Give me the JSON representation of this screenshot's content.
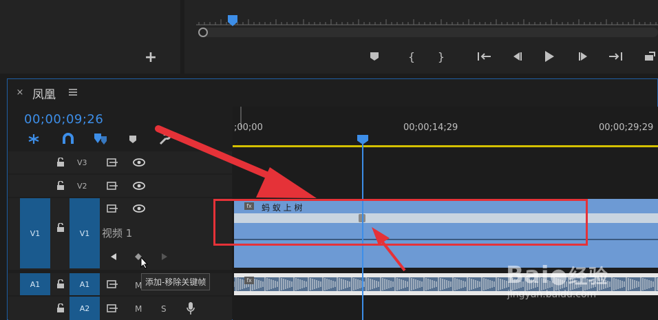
{
  "monitor": {
    "add_label": "+"
  },
  "timeline": {
    "sequence_name": "凤凰",
    "timecode": "00;00;09;26",
    "ruler_labels": [
      ";00;00",
      "00;00;14;29",
      "00;00;29;29"
    ],
    "tracks": {
      "v3": "V3",
      "v2": "V2",
      "v1_source": "V1",
      "v1_target": "V1",
      "v1_name": "视频 1",
      "a1_source": "A1",
      "a1_target": "A1",
      "a2": "A2",
      "mute": "M",
      "solo": "S"
    },
    "clip": {
      "fx": "fx",
      "title": "蚂 蚁 上 树"
    },
    "tooltip": "添加-移除关键帧"
  },
  "watermark": {
    "brand": "Bai",
    "brand_suffix": "经验",
    "url": "jingyan.baidu.com"
  },
  "colors": {
    "accent": "#3d8ee8",
    "clip": "#6d9ad4",
    "track_target": "#1a5a8e",
    "annotation": "#e53238",
    "work_area": "#d4c000"
  }
}
